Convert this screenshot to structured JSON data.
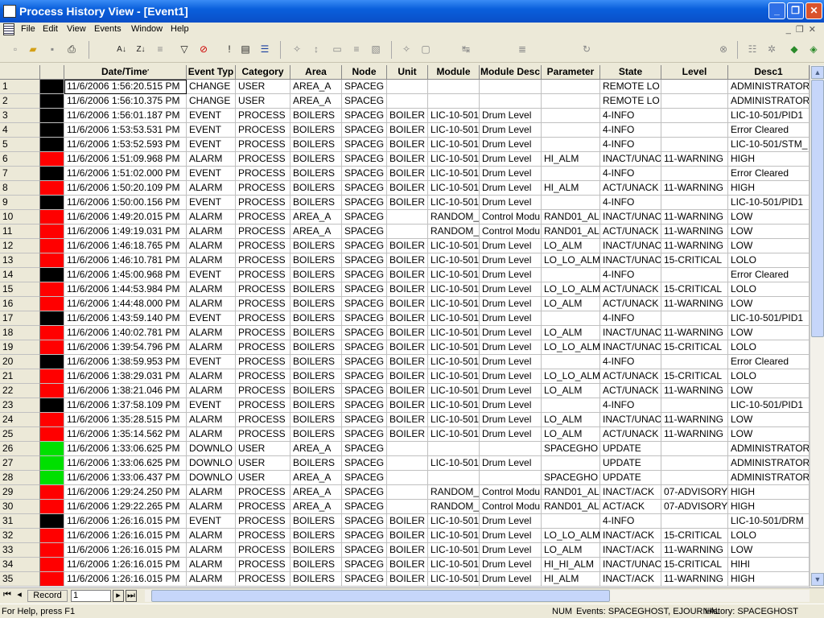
{
  "window": {
    "title": "Process History View - [Event1]"
  },
  "menu": [
    "File",
    "Edit",
    "View",
    "Events",
    "Window",
    "Help"
  ],
  "columns": [
    "",
    "",
    "Date/Time",
    "Event Typ",
    "Category",
    "Area",
    "Node",
    "Unit",
    "Module",
    "Module Desc",
    "Parameter",
    "State",
    "Level",
    "Desc1"
  ],
  "swatch_colors": {
    "black": "#000000",
    "red": "#ff0000",
    "green": "#00e000"
  },
  "rows": [
    [
      "1",
      "black",
      "11/6/2006 1:56:20.515 PM",
      "CHANGE",
      "USER",
      "AREA_A",
      "SPACEG",
      "",
      "",
      "",
      "",
      "REMOTE LO",
      "",
      "ADMINISTRATOR"
    ],
    [
      "2",
      "black",
      "11/6/2006 1:56:10.375 PM",
      "CHANGE",
      "USER",
      "AREA_A",
      "SPACEG",
      "",
      "",
      "",
      "",
      "REMOTE LO",
      "",
      "ADMINISTRATOR"
    ],
    [
      "3",
      "black",
      "11/6/2006 1:56:01.187 PM",
      "EVENT",
      "PROCESS",
      "BOILERS",
      "SPACEG",
      "BOILER",
      "LIC-10-501",
      "Drum Level",
      "",
      "4-INFO",
      "",
      "LIC-10-501/PID1"
    ],
    [
      "4",
      "black",
      "11/6/2006 1:53:53.531 PM",
      "EVENT",
      "PROCESS",
      "BOILERS",
      "SPACEG",
      "BOILER",
      "LIC-10-501",
      "Drum Level",
      "",
      "4-INFO",
      "",
      "Error Cleared"
    ],
    [
      "5",
      "black",
      "11/6/2006 1:53:52.593 PM",
      "EVENT",
      "PROCESS",
      "BOILERS",
      "SPACEG",
      "BOILER",
      "LIC-10-501",
      "Drum Level",
      "",
      "4-INFO",
      "",
      "LIC-10-501/STM_"
    ],
    [
      "6",
      "red",
      "11/6/2006 1:51:09.968 PM",
      "ALARM",
      "PROCESS",
      "BOILERS",
      "SPACEG",
      "BOILER",
      "LIC-10-501",
      "Drum Level",
      "HI_ALM",
      "INACT/UNAC",
      "11-WARNING",
      "HIGH"
    ],
    [
      "7",
      "black",
      "11/6/2006 1:51:02.000 PM",
      "EVENT",
      "PROCESS",
      "BOILERS",
      "SPACEG",
      "BOILER",
      "LIC-10-501",
      "Drum Level",
      "",
      "4-INFO",
      "",
      "Error Cleared"
    ],
    [
      "8",
      "red",
      "11/6/2006 1:50:20.109 PM",
      "ALARM",
      "PROCESS",
      "BOILERS",
      "SPACEG",
      "BOILER",
      "LIC-10-501",
      "Drum Level",
      "HI_ALM",
      "ACT/UNACK",
      "11-WARNING",
      "HIGH"
    ],
    [
      "9",
      "black",
      "11/6/2006 1:50:00.156 PM",
      "EVENT",
      "PROCESS",
      "BOILERS",
      "SPACEG",
      "BOILER",
      "LIC-10-501",
      "Drum Level",
      "",
      "4-INFO",
      "",
      "LIC-10-501/PID1"
    ],
    [
      "10",
      "red",
      "11/6/2006 1:49:20.015 PM",
      "ALARM",
      "PROCESS",
      "AREA_A",
      "SPACEG",
      "",
      "RANDOM_",
      "Control Modu",
      "RAND01_AL",
      "INACT/UNAC",
      "11-WARNING",
      "LOW"
    ],
    [
      "11",
      "red",
      "11/6/2006 1:49:19.031 PM",
      "ALARM",
      "PROCESS",
      "AREA_A",
      "SPACEG",
      "",
      "RANDOM_",
      "Control Modu",
      "RAND01_AL",
      "ACT/UNACK",
      "11-WARNING",
      "LOW"
    ],
    [
      "12",
      "red",
      "11/6/2006 1:46:18.765 PM",
      "ALARM",
      "PROCESS",
      "BOILERS",
      "SPACEG",
      "BOILER",
      "LIC-10-501",
      "Drum Level",
      "LO_ALM",
      "INACT/UNAC",
      "11-WARNING",
      "LOW"
    ],
    [
      "13",
      "red",
      "11/6/2006 1:46:10.781 PM",
      "ALARM",
      "PROCESS",
      "BOILERS",
      "SPACEG",
      "BOILER",
      "LIC-10-501",
      "Drum Level",
      "LO_LO_ALM",
      "INACT/UNAC",
      "15-CRITICAL",
      "LOLO"
    ],
    [
      "14",
      "black",
      "11/6/2006 1:45:00.968 PM",
      "EVENT",
      "PROCESS",
      "BOILERS",
      "SPACEG",
      "BOILER",
      "LIC-10-501",
      "Drum Level",
      "",
      "4-INFO",
      "",
      "Error Cleared"
    ],
    [
      "15",
      "red",
      "11/6/2006 1:44:53.984 PM",
      "ALARM",
      "PROCESS",
      "BOILERS",
      "SPACEG",
      "BOILER",
      "LIC-10-501",
      "Drum Level",
      "LO_LO_ALM",
      "ACT/UNACK",
      "15-CRITICAL",
      "LOLO"
    ],
    [
      "16",
      "red",
      "11/6/2006 1:44:48.000 PM",
      "ALARM",
      "PROCESS",
      "BOILERS",
      "SPACEG",
      "BOILER",
      "LIC-10-501",
      "Drum Level",
      "LO_ALM",
      "ACT/UNACK",
      "11-WARNING",
      "LOW"
    ],
    [
      "17",
      "black",
      "11/6/2006 1:43:59.140 PM",
      "EVENT",
      "PROCESS",
      "BOILERS",
      "SPACEG",
      "BOILER",
      "LIC-10-501",
      "Drum Level",
      "",
      "4-INFO",
      "",
      "LIC-10-501/PID1"
    ],
    [
      "18",
      "red",
      "11/6/2006 1:40:02.781 PM",
      "ALARM",
      "PROCESS",
      "BOILERS",
      "SPACEG",
      "BOILER",
      "LIC-10-501",
      "Drum Level",
      "LO_ALM",
      "INACT/UNAC",
      "11-WARNING",
      "LOW"
    ],
    [
      "19",
      "red",
      "11/6/2006 1:39:54.796 PM",
      "ALARM",
      "PROCESS",
      "BOILERS",
      "SPACEG",
      "BOILER",
      "LIC-10-501",
      "Drum Level",
      "LO_LO_ALM",
      "INACT/UNAC",
      "15-CRITICAL",
      "LOLO"
    ],
    [
      "20",
      "black",
      "11/6/2006 1:38:59.953 PM",
      "EVENT",
      "PROCESS",
      "BOILERS",
      "SPACEG",
      "BOILER",
      "LIC-10-501",
      "Drum Level",
      "",
      "4-INFO",
      "",
      "Error Cleared"
    ],
    [
      "21",
      "red",
      "11/6/2006 1:38:29.031 PM",
      "ALARM",
      "PROCESS",
      "BOILERS",
      "SPACEG",
      "BOILER",
      "LIC-10-501",
      "Drum Level",
      "LO_LO_ALM",
      "ACT/UNACK",
      "15-CRITICAL",
      "LOLO"
    ],
    [
      "22",
      "red",
      "11/6/2006 1:38:21.046 PM",
      "ALARM",
      "PROCESS",
      "BOILERS",
      "SPACEG",
      "BOILER",
      "LIC-10-501",
      "Drum Level",
      "LO_ALM",
      "ACT/UNACK",
      "11-WARNING",
      "LOW"
    ],
    [
      "23",
      "black",
      "11/6/2006 1:37:58.109 PM",
      "EVENT",
      "PROCESS",
      "BOILERS",
      "SPACEG",
      "BOILER",
      "LIC-10-501",
      "Drum Level",
      "",
      "4-INFO",
      "",
      "LIC-10-501/PID1"
    ],
    [
      "24",
      "red",
      "11/6/2006 1:35:28.515 PM",
      "ALARM",
      "PROCESS",
      "BOILERS",
      "SPACEG",
      "BOILER",
      "LIC-10-501",
      "Drum Level",
      "LO_ALM",
      "INACT/UNAC",
      "11-WARNING",
      "LOW"
    ],
    [
      "25",
      "red",
      "11/6/2006 1:35:14.562 PM",
      "ALARM",
      "PROCESS",
      "BOILERS",
      "SPACEG",
      "BOILER",
      "LIC-10-501",
      "Drum Level",
      "LO_ALM",
      "ACT/UNACK",
      "11-WARNING",
      "LOW"
    ],
    [
      "26",
      "green",
      "11/6/2006 1:33:06.625 PM",
      "DOWNLO",
      "USER",
      "AREA_A",
      "SPACEG",
      "",
      "",
      "",
      "SPACEGHO",
      "UPDATE",
      "",
      "ADMINISTRATOR"
    ],
    [
      "27",
      "green",
      "11/6/2006 1:33:06.625 PM",
      "DOWNLO",
      "USER",
      "BOILERS",
      "SPACEG",
      "",
      "LIC-10-501",
      "Drum Level",
      "",
      "UPDATE",
      "",
      "ADMINISTRATOR"
    ],
    [
      "28",
      "green",
      "11/6/2006 1:33:06.437 PM",
      "DOWNLO",
      "USER",
      "AREA_A",
      "SPACEG",
      "",
      "",
      "",
      "SPACEGHO",
      "UPDATE",
      "",
      "ADMINISTRATOR"
    ],
    [
      "29",
      "red",
      "11/6/2006 1:29:24.250 PM",
      "ALARM",
      "PROCESS",
      "AREA_A",
      "SPACEG",
      "",
      "RANDOM_",
      "Control Modu",
      "RAND01_AL",
      "INACT/ACK",
      "07-ADVISORY",
      "HIGH"
    ],
    [
      "30",
      "red",
      "11/6/2006 1:29:22.265 PM",
      "ALARM",
      "PROCESS",
      "AREA_A",
      "SPACEG",
      "",
      "RANDOM_",
      "Control Modu",
      "RAND01_AL",
      "ACT/ACK",
      "07-ADVISORY",
      "HIGH"
    ],
    [
      "31",
      "black",
      "11/6/2006 1:26:16.015 PM",
      "EVENT",
      "PROCESS",
      "BOILERS",
      "SPACEG",
      "BOILER",
      "LIC-10-501",
      "Drum Level",
      "",
      "4-INFO",
      "",
      "LIC-10-501/DRM"
    ],
    [
      "32",
      "red",
      "11/6/2006 1:26:16.015 PM",
      "ALARM",
      "PROCESS",
      "BOILERS",
      "SPACEG",
      "BOILER",
      "LIC-10-501",
      "Drum Level",
      "LO_LO_ALM",
      "INACT/ACK",
      "15-CRITICAL",
      "LOLO"
    ],
    [
      "33",
      "red",
      "11/6/2006 1:26:16.015 PM",
      "ALARM",
      "PROCESS",
      "BOILERS",
      "SPACEG",
      "BOILER",
      "LIC-10-501",
      "Drum Level",
      "LO_ALM",
      "INACT/ACK",
      "11-WARNING",
      "LOW"
    ],
    [
      "34",
      "red",
      "11/6/2006 1:26:16.015 PM",
      "ALARM",
      "PROCESS",
      "BOILERS",
      "SPACEG",
      "BOILER",
      "LIC-10-501",
      "Drum Level",
      "HI_HI_ALM",
      "INACT/UNAC",
      "15-CRITICAL",
      "HIHI"
    ],
    [
      "35",
      "red",
      "11/6/2006 1:26:16.015 PM",
      "ALARM",
      "PROCESS",
      "BOILERS",
      "SPACEG",
      "BOILER",
      "LIC-10-501",
      "Drum Level",
      "HI_ALM",
      "INACT/ACK",
      "11-WARNING",
      "HIGH"
    ]
  ],
  "navigator": {
    "label": "Record",
    "value": "1"
  },
  "status": {
    "help": "For Help, press F1",
    "num": "NUM",
    "events": "Events: SPACEGHOST, EJOURNAL",
    "history": "History: SPACEGHOST"
  }
}
